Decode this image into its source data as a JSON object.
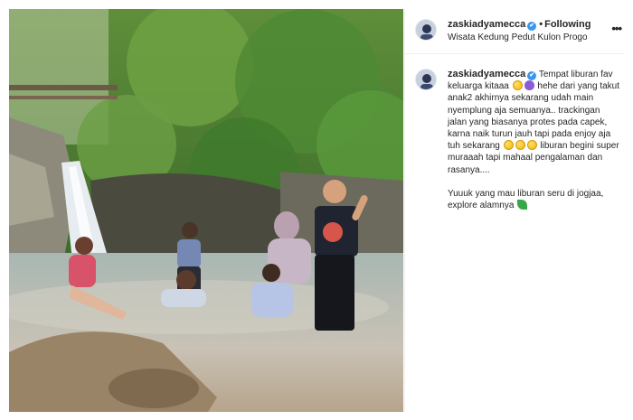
{
  "post": {
    "username": "zaskiadyamecca",
    "verified_mark": "✔",
    "separator": "•",
    "follow_status": "Following",
    "location": "Wisata Kedung Pedut Kulon Progo",
    "more_icon": "more-options-icon"
  },
  "caption": {
    "username": "zaskiadyamecca",
    "part1": " Tempat liburan fav keluarga kitaaa ",
    "part2": " hehe dari yang takut anak2 akhirnya sekarang udah main nyemplung aja semuanya.. trackingan jalan yang biasanya protes pada capek, karna naik turun jauh tapi pada enjoy aja tuh sekarang ",
    "part3": " liburan begini super muraaah tapi mahaal pengalaman dan rasanya....",
    "part4": "Yuuuk yang mau liburan seru di jogjaa, explore alamnya ",
    "emojis": [
      "smiling-face",
      "purple-heart",
      "smiling-face",
      "smiling-face",
      "smiling-face",
      "leaf"
    ]
  },
  "colors": {
    "verified": "#3897f0",
    "text": "#262626",
    "divider": "#efefef"
  }
}
